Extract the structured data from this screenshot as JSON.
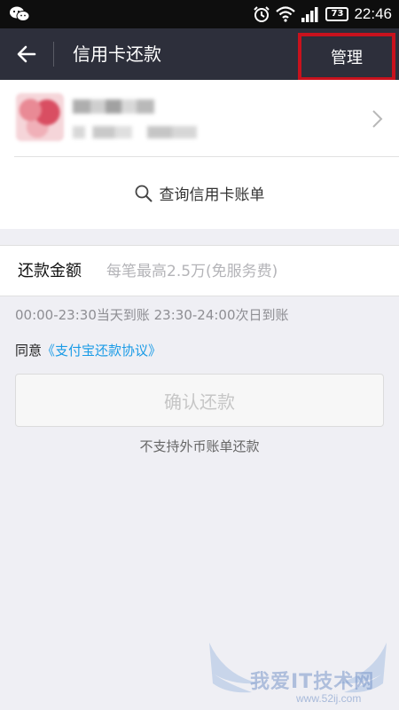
{
  "status_bar": {
    "battery": "73",
    "time": "22:46"
  },
  "nav": {
    "title": "信用卡还款",
    "manage_label": "管理"
  },
  "card": {
    "query_label": "查询信用卡账单"
  },
  "repay": {
    "amount_label": "还款金额",
    "amount_placeholder": "每笔最高2.5万(免服务费)",
    "time_note": "00:00-23:30当天到账  23:30-24:00次日到账",
    "agree_prefix": "同意",
    "agreement_link": "《支付宝还款协议》",
    "confirm_label": "确认还款",
    "foreign_note": "不支持外币账单还款"
  },
  "watermark": {
    "text": "我爱IT技术网",
    "url": "www.52ij.com"
  },
  "colors": {
    "nav_bg": "#2d2f3b",
    "highlight_box": "#c8121d",
    "link": "#1a9be6",
    "page_bg": "#efeff4"
  }
}
